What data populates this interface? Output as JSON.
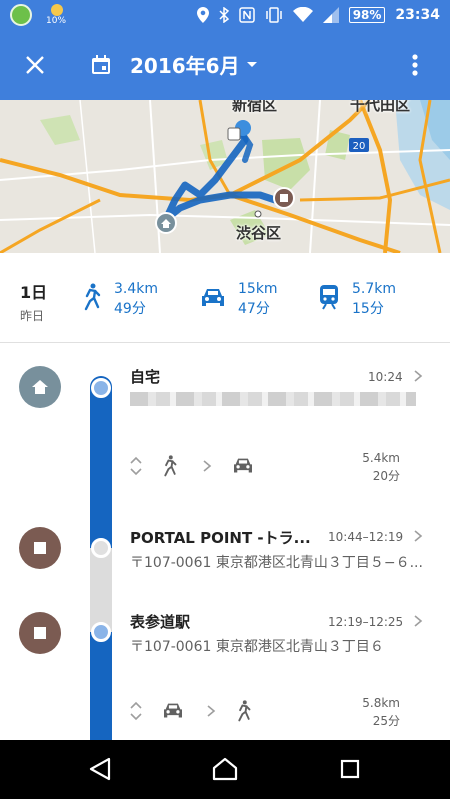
{
  "status_bar": {
    "battery": "98%",
    "time": "23:34",
    "moon_percent": "10%"
  },
  "app_bar": {
    "title": "2016年6月"
  },
  "map": {
    "labels": [
      "新宿区",
      "千代田区",
      "渋谷区"
    ],
    "route_shield": "20",
    "colors": {
      "route": "#1565c0",
      "highway": "#f5a623",
      "park": "#c8dfa8",
      "water": "#9ccbe8"
    }
  },
  "summary": {
    "day": "1日",
    "day_sub": "昨日",
    "walk": {
      "distance": "3.4km",
      "duration": "49分"
    },
    "car": {
      "distance": "15km",
      "duration": "47分"
    },
    "train": {
      "distance": "5.7km",
      "duration": "15分"
    }
  },
  "timeline": {
    "home": {
      "title": "自宅",
      "time": "10:24"
    },
    "move1": {
      "distance": "5.4km",
      "duration": "20分"
    },
    "place1": {
      "title": "PORTAL POINT -トラ...",
      "time": "10:44–12:19",
      "address": "〒107-0061 東京都港区北青山３丁目５−６..."
    },
    "place2": {
      "title": "表参道駅",
      "time": "12:19–12:25",
      "address": "〒107-0061 東京都港区北青山３丁目６"
    },
    "move2": {
      "distance": "5.8km",
      "duration": "25分"
    }
  },
  "accent_colors": {
    "primary": "#3f7fdc",
    "link": "#1a73c8",
    "track": "#1565c0",
    "home_dot": "#78909c",
    "stop_dot": "#7b5b52"
  }
}
